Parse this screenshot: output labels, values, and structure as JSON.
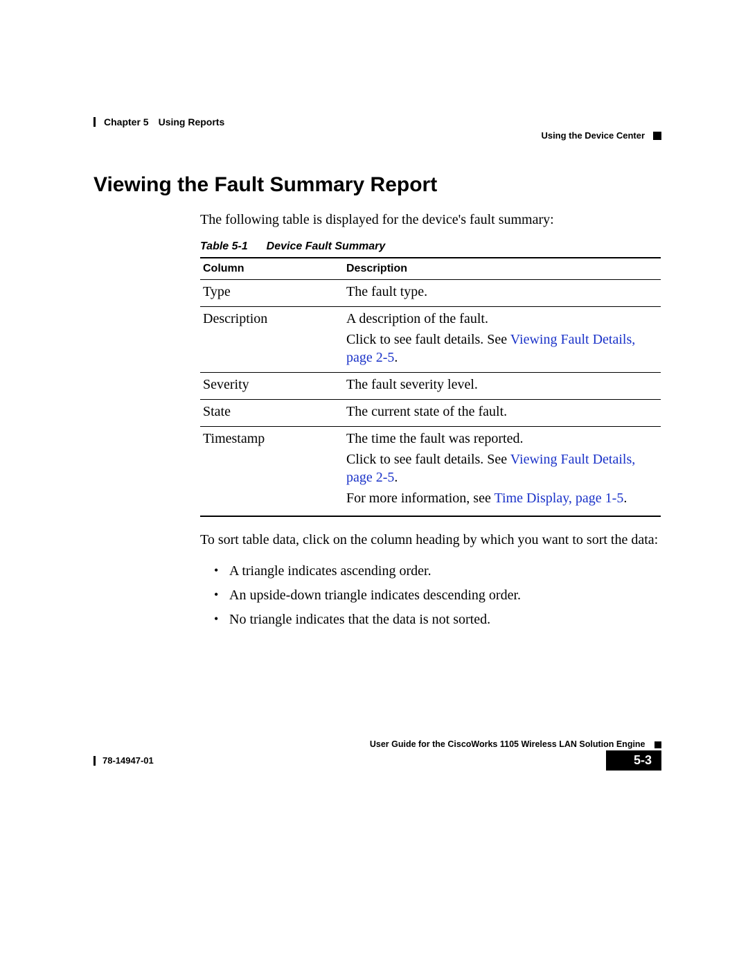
{
  "header": {
    "chapter_label": "Chapter 5",
    "chapter_title": "Using Reports",
    "section_right": "Using the Device Center"
  },
  "body": {
    "heading": "Viewing the Fault Summary Report",
    "intro": "The following table is displayed for the device's fault summary:",
    "table_caption_prefix": "Table 5-1",
    "table_caption_title": "Device Fault Summary",
    "table": {
      "col_headers": {
        "c1": "Column",
        "c2": "Description"
      },
      "rows": [
        {
          "col": "Type",
          "desc": [
            {
              "plain": "The fault type."
            }
          ]
        },
        {
          "col": "Description",
          "desc": [
            {
              "plain": "A description of the fault."
            },
            {
              "pre": "Click to see fault details. See ",
              "link": "Viewing Fault Details, page 2-5",
              "post": "."
            }
          ]
        },
        {
          "col": "Severity",
          "desc": [
            {
              "plain": "The fault severity level."
            }
          ]
        },
        {
          "col": "State",
          "desc": [
            {
              "plain": "The current state of the fault."
            }
          ]
        },
        {
          "col": "Timestamp",
          "desc": [
            {
              "plain": "The time the fault was reported."
            },
            {
              "pre": "Click to see fault details. See ",
              "link": "Viewing Fault Details, page 2-5",
              "post": "."
            },
            {
              "pre": "For more information, see ",
              "link": "Time Display, page 1-5",
              "post": "."
            }
          ]
        }
      ]
    },
    "post_table_text": "To sort table data, click on the column heading by which you want to sort the data:",
    "bullets": [
      "A triangle indicates ascending order.",
      "An upside-down triangle indicates descending order.",
      "No triangle indicates that the data is not sorted."
    ]
  },
  "footer": {
    "book_title": "User Guide for the CiscoWorks 1105 Wireless LAN Solution Engine",
    "doc_number": "78-14947-01",
    "page_number": "5-3"
  }
}
